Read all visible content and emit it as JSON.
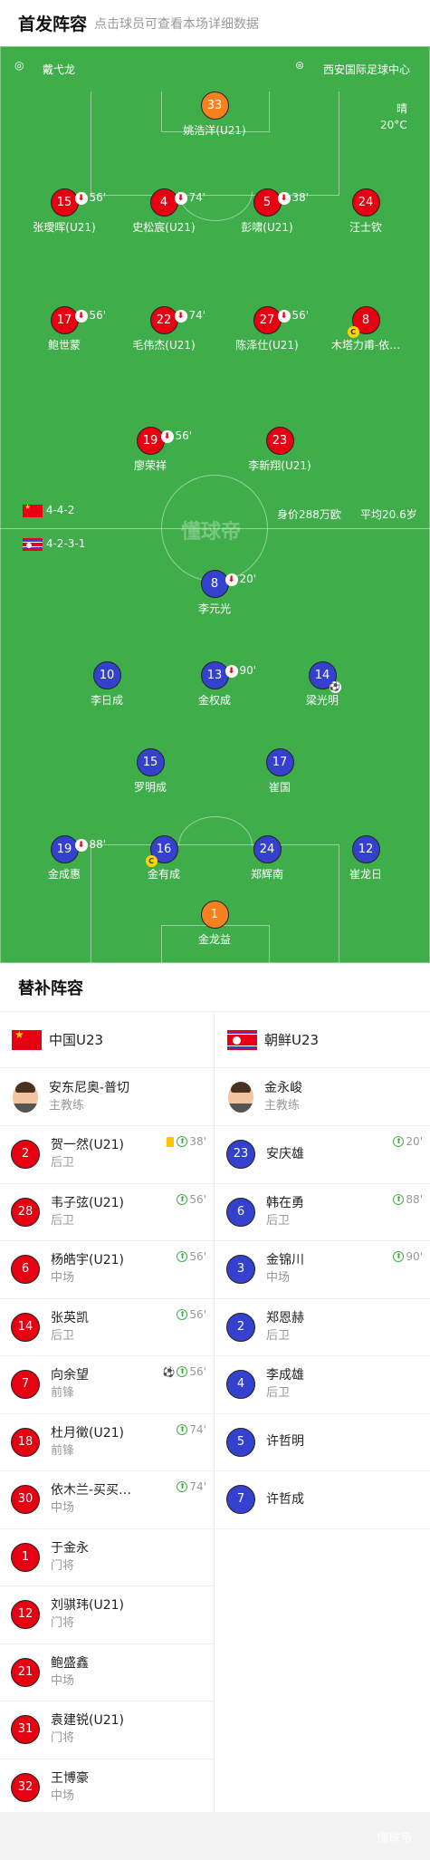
{
  "header": {
    "title": "首发阵容",
    "subtitle": "点击球员可查看本场详细数据"
  },
  "pitch": {
    "referee": "戴弋龙",
    "venue": "西安国际足球中心",
    "weather": "晴",
    "temperature": "20°C",
    "watermark": "懂球帝",
    "home": {
      "formation": "4-4-2",
      "value": "身价288万欧",
      "age": "平均20.6岁"
    },
    "away": {
      "formation": "4-2-3-1"
    }
  },
  "home_players": [
    {
      "num": "33",
      "name": "姚浩洋(U21)",
      "color": "orange"
    },
    {
      "num": "15",
      "name": "张璦晖(U21)",
      "sub": "56'"
    },
    {
      "num": "4",
      "name": "史松宸(U21)",
      "sub": "74'"
    },
    {
      "num": "5",
      "name": "彭啸(U21)",
      "sub": "38'"
    },
    {
      "num": "24",
      "name": "汪士钦"
    },
    {
      "num": "17",
      "name": "鲍世蒙",
      "sub": "56'"
    },
    {
      "num": "22",
      "name": "毛伟杰(U21)",
      "sub": "74'"
    },
    {
      "num": "27",
      "name": "陈泽仕(U21)",
      "sub": "56'"
    },
    {
      "num": "8",
      "name": "木塔力甫-依…",
      "captain": "C"
    },
    {
      "num": "19",
      "name": "廖荣祥",
      "sub": "56'"
    },
    {
      "num": "23",
      "name": "李新翔(U21)"
    }
  ],
  "away_players": [
    {
      "num": "8",
      "name": "李元光",
      "sub": "20'"
    },
    {
      "num": "10",
      "name": "李日成"
    },
    {
      "num": "13",
      "name": "金权成",
      "sub": "90'"
    },
    {
      "num": "14",
      "name": "梁光明",
      "goal": "⚽"
    },
    {
      "num": "15",
      "name": "罗明成"
    },
    {
      "num": "17",
      "name": "崔国"
    },
    {
      "num": "19",
      "name": "金成惠",
      "sub": "88'"
    },
    {
      "num": "16",
      "name": "金有成",
      "captain": "C"
    },
    {
      "num": "24",
      "name": "郑辉南"
    },
    {
      "num": "12",
      "name": "崔龙日"
    },
    {
      "num": "1",
      "name": "金龙益",
      "color": "orange"
    }
  ],
  "subs": {
    "title": "替补阵容",
    "home": {
      "team": "中国U23",
      "coach": {
        "name": "安东尼奥-普切",
        "role": "主教练"
      },
      "players": [
        {
          "num": "2",
          "name": "贺一然(U21)",
          "pos": "后卫",
          "card": "yellow",
          "time": "38'"
        },
        {
          "num": "28",
          "name": "韦子弦(U21)",
          "pos": "后卫",
          "time": "56'"
        },
        {
          "num": "6",
          "name": "杨皓宇(U21)",
          "pos": "中场",
          "time": "56'"
        },
        {
          "num": "14",
          "name": "张英凯",
          "pos": "后卫",
          "time": "56'"
        },
        {
          "num": "7",
          "name": "向余望",
          "pos": "前锋",
          "goal": "⚽",
          "time": "56'"
        },
        {
          "num": "18",
          "name": "杜月徵(U21)",
          "pos": "前锋",
          "time": "74'"
        },
        {
          "num": "30",
          "name": "依木兰-买买…",
          "pos": "中场",
          "time": "74'"
        },
        {
          "num": "1",
          "name": "于金永",
          "pos": "门将"
        },
        {
          "num": "12",
          "name": "刘骐玮(U21)",
          "pos": "门将"
        },
        {
          "num": "21",
          "name": "鲍盛鑫",
          "pos": "中场"
        },
        {
          "num": "31",
          "name": "袁建锐(U21)",
          "pos": "门将"
        },
        {
          "num": "32",
          "name": "王博豪",
          "pos": "中场"
        }
      ]
    },
    "away": {
      "team": "朝鲜U23",
      "coach": {
        "name": "金永峻",
        "role": "主教练"
      },
      "players": [
        {
          "num": "23",
          "name": "安庆雄",
          "pos": "",
          "time": "20'"
        },
        {
          "num": "6",
          "name": "韩在勇",
          "pos": "后卫",
          "time": "88'"
        },
        {
          "num": "3",
          "name": "金锦川",
          "pos": "中场",
          "time": "90'"
        },
        {
          "num": "2",
          "name": "郑恩赫",
          "pos": "后卫"
        },
        {
          "num": "4",
          "name": "李成雄",
          "pos": "后卫"
        },
        {
          "num": "5",
          "name": "许哲明",
          "pos": ""
        },
        {
          "num": "7",
          "name": "许哲成",
          "pos": ""
        }
      ]
    }
  },
  "footer": {
    "watermark": "懂球帝"
  }
}
